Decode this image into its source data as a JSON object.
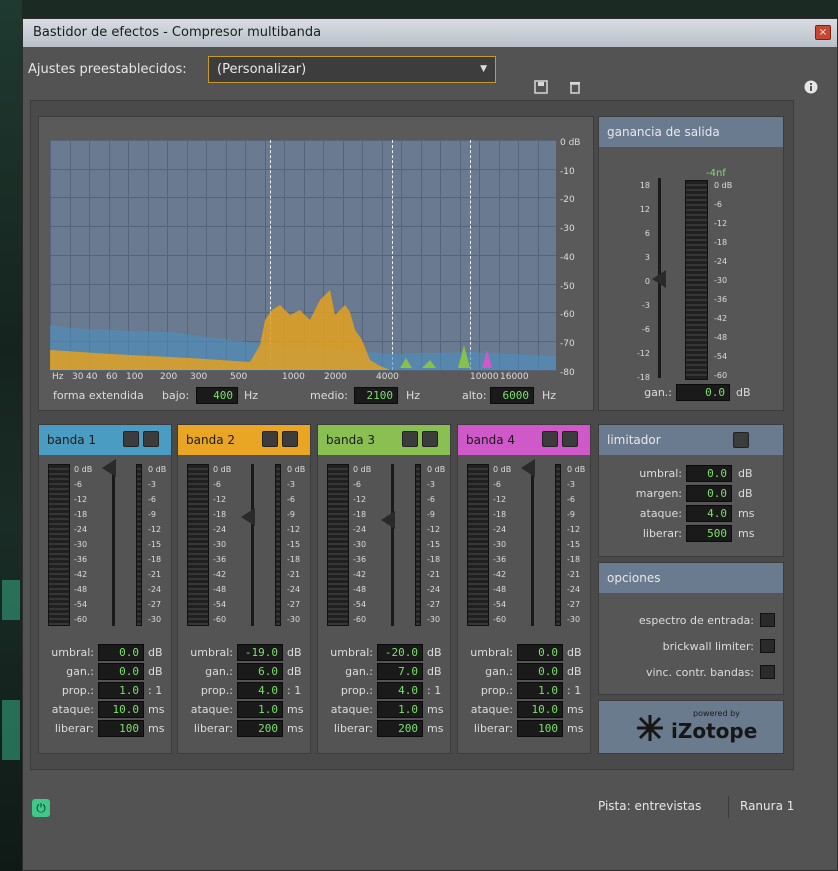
{
  "window": {
    "title": "Bastidor de efectos - Compresor multibanda",
    "close_glyph": "×"
  },
  "presets": {
    "label": "Ajustes preestablecidos:",
    "value": "(Personalizar)"
  },
  "icons": {
    "save": "save-icon",
    "delete": "trash-icon",
    "info": "info-icon",
    "power": "power-icon"
  },
  "spectrum": {
    "db_labels": [
      "0 dB",
      "-10",
      "-20",
      "-30",
      "-40",
      "-50",
      "-60",
      "-70",
      "-80"
    ],
    "freq_labels": [
      "Hz",
      "30",
      "40",
      "60",
      "100",
      "200",
      "300",
      "500",
      "1000",
      "2000",
      "4000",
      "10000",
      "16000"
    ],
    "forma_extendida": "forma extendida",
    "bajo_label": "bajo:",
    "bajo_value": "400",
    "bajo_unit": "Hz",
    "medio_label": "medio:",
    "medio_value": "2100",
    "medio_unit": "Hz",
    "alto_label": "alto:",
    "alto_value": "6000",
    "alto_unit": "Hz"
  },
  "output_gain": {
    "title": "ganancia de salida",
    "peak": "-4nf",
    "scale_left": [
      "18",
      "12",
      "6",
      "3",
      "0",
      "-3",
      "-6",
      "-12",
      "-18"
    ],
    "scale_right": [
      "0 dB",
      "-6",
      "-12",
      "-18",
      "-24",
      "-30",
      "-36",
      "-42",
      "-48",
      "-54",
      "-60"
    ],
    "gan_label": "gan.:",
    "gan_value": "0.0",
    "gan_unit": "dB"
  },
  "bands": [
    {
      "name": "banda 1",
      "color": "#4a9cc2",
      "umbral": "0.0",
      "gan": "0.0",
      "prop": "1.0",
      "ataque": "10.0",
      "liberar": "100",
      "thumb_level": 0.02
    },
    {
      "name": "banda 2",
      "color": "#e9a524",
      "umbral": "-19.0",
      "gan": "6.0",
      "prop": "4.0",
      "ataque": "1.0",
      "liberar": "200",
      "thumb_level": 0.32
    },
    {
      "name": "banda 3",
      "color": "#8ac052",
      "umbral": "-20.0",
      "gan": "7.0",
      "prop": "4.0",
      "ataque": "1.0",
      "liberar": "200",
      "thumb_level": 0.34
    },
    {
      "name": "banda 4",
      "color": "#cf59c8",
      "umbral": "0.0",
      "gan": "0.0",
      "prop": "1.0",
      "ataque": "10.0",
      "liberar": "100",
      "thumb_level": 0.02
    }
  ],
  "band_labels": {
    "umbral": "umbral:",
    "gan": "gan.:",
    "prop": "prop.:",
    "ataque": "ataque:",
    "liberar": "liberar:",
    "db": "dB",
    "ratio": ": 1",
    "ms": "ms"
  },
  "band_meter_left": [
    "0 dB",
    "-6",
    "-12",
    "-18",
    "-24",
    "-30",
    "-36",
    "-42",
    "-48",
    "-54",
    "-60"
  ],
  "band_meter_right": [
    "0 dB",
    "-3",
    "-6",
    "-9",
    "-12",
    "-15",
    "-18",
    "-21",
    "-24",
    "-27",
    "-30"
  ],
  "limiter": {
    "title": "limitador",
    "umbral_label": "umbral:",
    "umbral_value": "0.0",
    "umbral_unit": "dB",
    "margen_label": "margen:",
    "margen_value": "0.0",
    "margen_unit": "dB",
    "ataque_label": "ataque:",
    "ataque_value": "4.0",
    "ataque_unit": "ms",
    "liberar_label": "liberar:",
    "liberar_value": "500",
    "liberar_unit": "ms"
  },
  "options": {
    "title": "opciones",
    "espectro": "espectro de entrada:",
    "brickwall": "brickwall limiter:",
    "vinc": "vinc. contr. bandas:"
  },
  "logo": {
    "powered": "powered by",
    "brand": "iZotope"
  },
  "footer": {
    "track": "Pista: entrevistas",
    "slot": "Ranura 1"
  }
}
